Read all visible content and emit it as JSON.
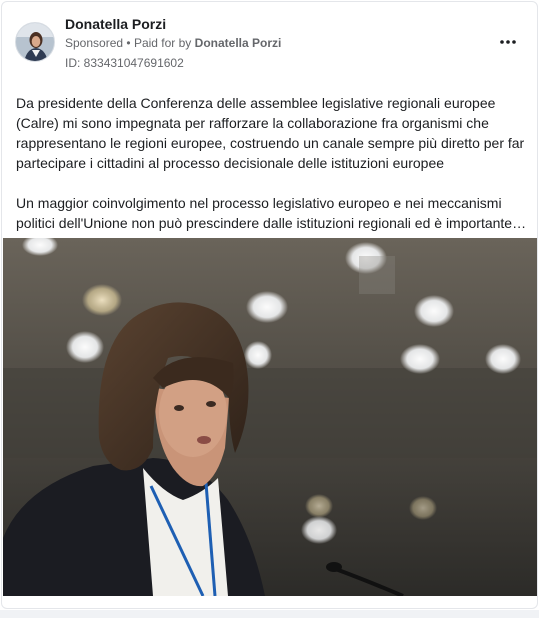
{
  "post": {
    "author_name": "Donatella Porzi",
    "sponsored_label": "Sponsored",
    "separator": "•",
    "paid_for_prefix": "Paid for by",
    "paid_for_name": "Donatella Porzi",
    "ad_id": "ID: 833431047691602",
    "more_options": "•••",
    "paragraphs": [
      "Da presidente della Conferenza delle assemblee legislative regionali europee (Calre) mi sono impegnata per rafforzare la collaborazione fra organismi che rappresentano le regioni europee, costruendo un canale sempre più diretto per far partecipare i cittadini al processo decisionale delle istituzioni europee",
      "Un maggior coinvolgimento nel processo legislativo europeo e nei meccanismi politici dell'Unione non può prescindere dalle istituzioni regionali ed è importante…"
    ]
  },
  "colors": {
    "text_primary": "#1c1e21",
    "text_secondary": "#65676b",
    "card_border": "#e4e6ea",
    "lanyard": "#1e5fb3"
  }
}
